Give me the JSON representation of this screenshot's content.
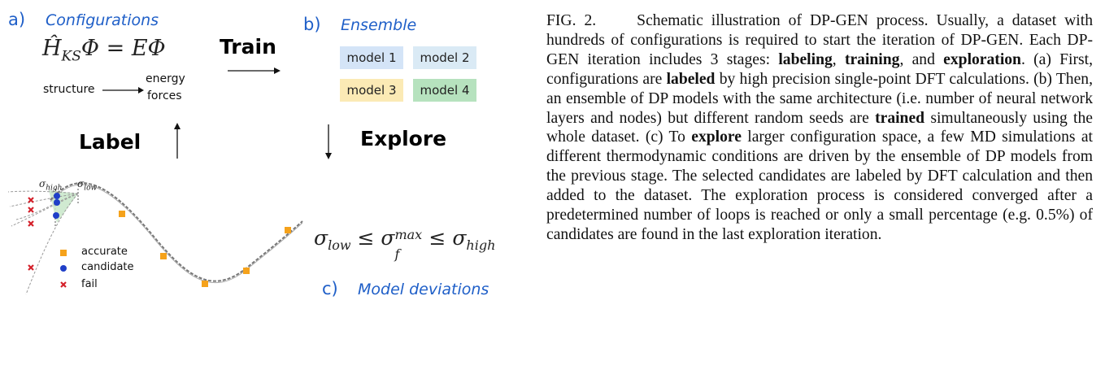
{
  "panel_a": {
    "letter": "a)",
    "title": "Configurations",
    "equation": "Ĥ",
    "equation_sub": "KS",
    "equation_rest": "Φ = EΦ",
    "structure_label": "structure",
    "energy_label": "energy",
    "forces_label": "forces"
  },
  "panel_b": {
    "letter": "b)",
    "title": "Ensemble",
    "models": [
      "model 1",
      "model 2",
      "model 3",
      "model 4"
    ],
    "model_colors": [
      "#d4e4f7",
      "#daeaf5",
      "#fbeab5",
      "#b6e2be"
    ]
  },
  "panel_c": {
    "letter": "c)",
    "title": "Model deviations",
    "inequality_low": "σ",
    "inequality_low_sub": "low",
    "inequality_le": "≤",
    "inequality_mid": "σ",
    "inequality_mid_sub": "f",
    "inequality_mid_sup": "max",
    "inequality_high": "σ",
    "inequality_high_sub": "high"
  },
  "steps": {
    "train": "Train",
    "explore": "Explore",
    "label": "Label"
  },
  "plot": {
    "sigma_high": "σ",
    "sigma_high_sub": "high",
    "sigma_low": "σ",
    "sigma_low_sub": "low",
    "legend": [
      "accurate",
      "candidate",
      "fail"
    ],
    "colors": {
      "accurate": "#f5a21b",
      "candidate": "#1f3fc8",
      "fail": "#d4202a"
    }
  },
  "caption": {
    "fig_label": "FIG. 2.",
    "s1": "Schematic illustration of DP-GEN process. Usually, a dataset with hundreds of configurations is required to start the iteration of DP-GEN. Each DP-GEN iteration includes 3 stages: ",
    "b1": "labeling",
    "s2": ", ",
    "b2": "training",
    "s3": ", and ",
    "b3": "exploration",
    "s4": ". (a) First, configurations are ",
    "b4": "labeled",
    "s5": " by high precision single-point DFT calculations. (b) Then, an ensemble of DP models with the same architecture (i.e. number of neural network layers and nodes) but different random seeds are ",
    "b5": "trained",
    "s6": " simultaneously using the whole dataset. (c) To ",
    "b6": "explore",
    "s7": " larger configuration space, a few MD simulations at different thermodynamic conditions are driven by the ensemble of DP models from the previous stage. The selected candidates are labeled by DFT calculation and then added to the dataset. The exploration process is considered converged after a predetermined number of loops is reached or only a small percentage (e.g. 0.5%) of candidates are found in the last exploration iteration."
  }
}
